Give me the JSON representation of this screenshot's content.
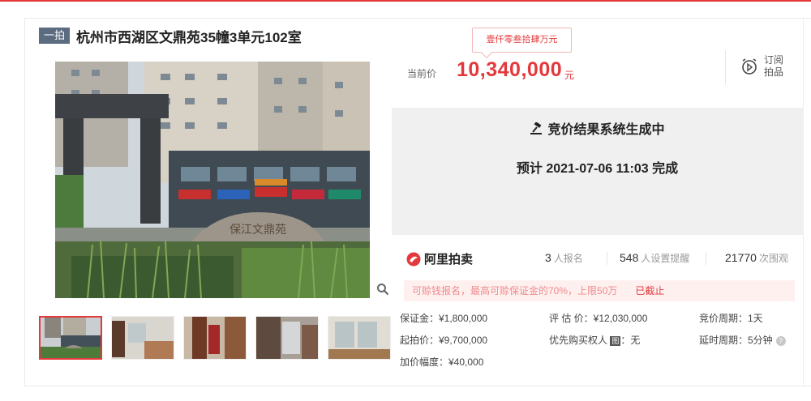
{
  "header": {
    "tag": "一拍",
    "title": "杭州市西湖区文鼎苑35幢3单元102室"
  },
  "gallery": {
    "main_sign_text": "保江文鼎苑",
    "shop_signs": [
      "信都聚",
      "CBD国际",
      "新世纪华",
      "口腔医院",
      "润"
    ]
  },
  "price": {
    "tooltip": "壹仟零叁拾肆万元",
    "label": "当前价",
    "value": "10,340,000",
    "unit": "元"
  },
  "subscribe": {
    "line1": "订阅",
    "line2": "拍品"
  },
  "result": {
    "title": "竞价结果系统生成中",
    "time": "预计 2021-07-06 11:03 完成"
  },
  "platform": {
    "name": "阿里拍卖"
  },
  "stats": [
    {
      "value": "3",
      "label": "人报名"
    },
    {
      "value": "548",
      "label": "人设置提醒"
    },
    {
      "value": "21770",
      "label": "次围观"
    }
  ],
  "notice": {
    "text": "可赊钱报名，最高可赊保证金的70%，上限50万",
    "status": "已截止"
  },
  "info": {
    "deposit": "保证金：¥1,800,000",
    "start_price": "起拍价：¥9,700,000",
    "increment": "加价幅度：¥40,000",
    "assessed": "评 估 价：¥12,030,000",
    "priority_label": "优先购买权人",
    "priority_badge": "图",
    "priority_value": "：无",
    "cycle": "竞价周期：1天",
    "delay": "延时周期：5分钟"
  },
  "colors": {
    "accent": "#e4393c",
    "tag_bg": "#5b6b80",
    "result_bg": "#f0f0f0"
  }
}
